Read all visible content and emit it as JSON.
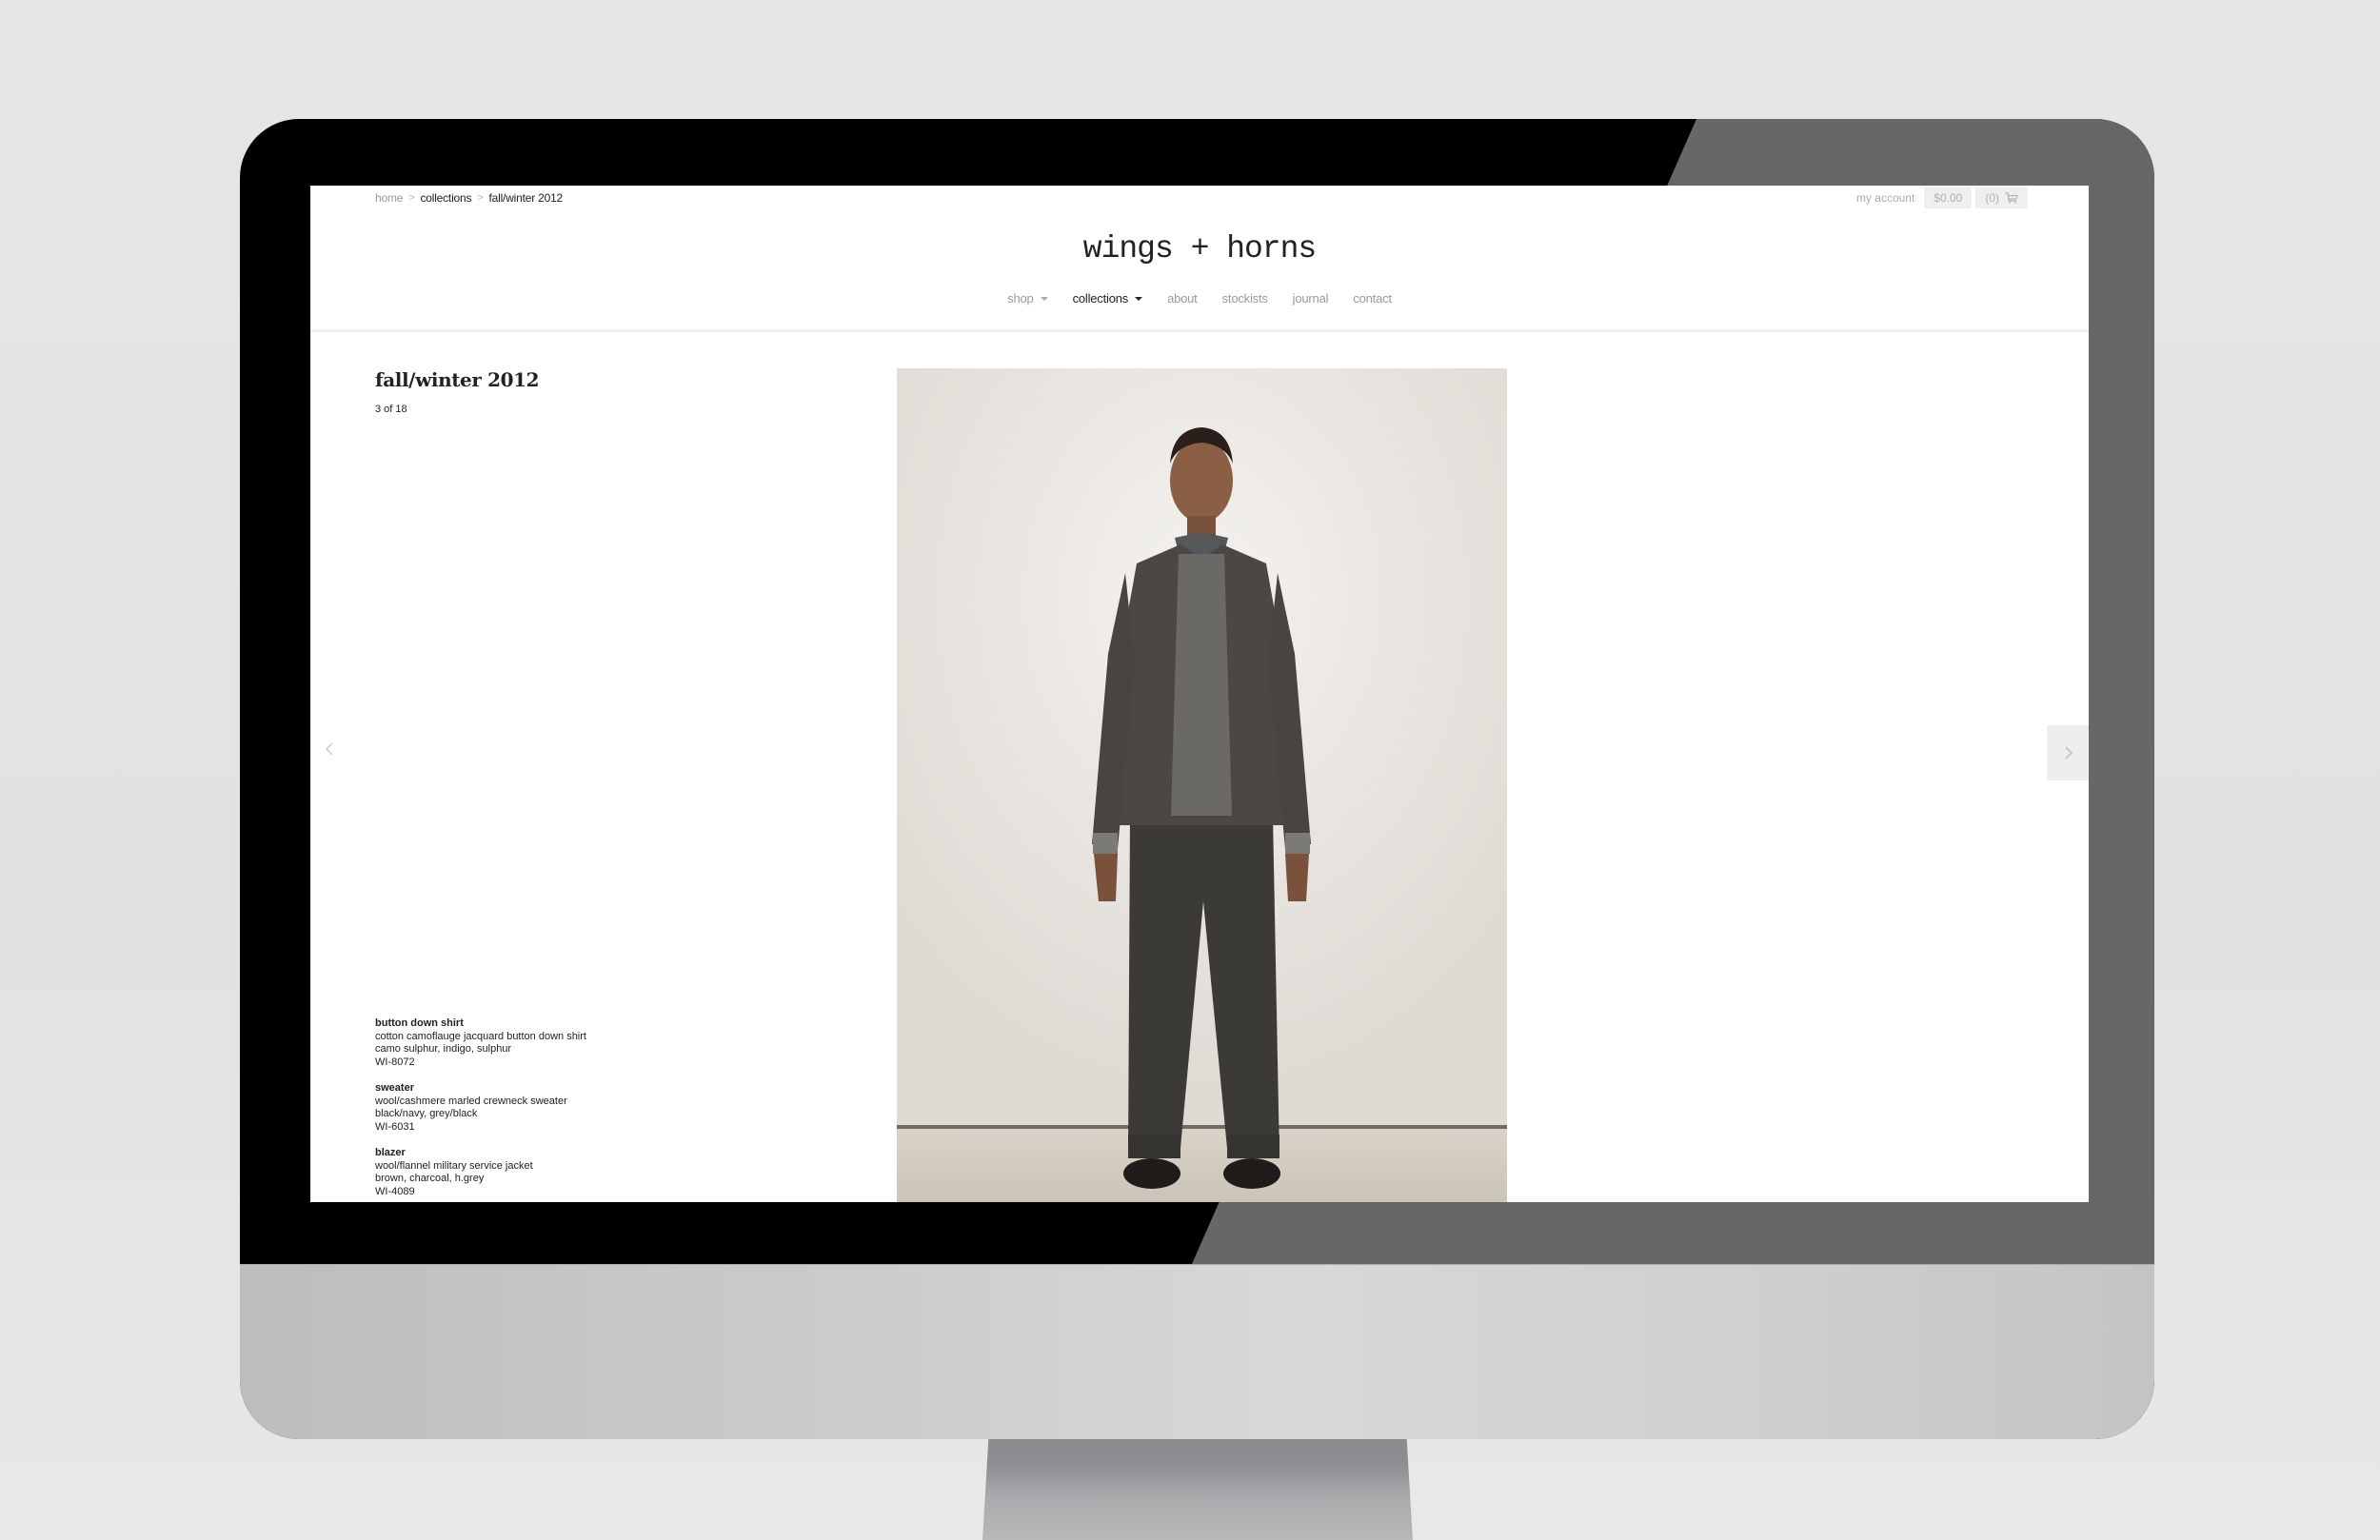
{
  "breadcrumb": {
    "items": [
      "home",
      "collections",
      "fall/winter 2012"
    ],
    "separator": ">"
  },
  "account": {
    "my_account_label": "my account",
    "cart_total": "$0.00",
    "cart_count": "(0)"
  },
  "brand": {
    "logo_text": "wings + horns"
  },
  "nav": {
    "items": [
      {
        "label": "shop",
        "has_dropdown": true,
        "active": false
      },
      {
        "label": "collections",
        "has_dropdown": true,
        "active": true
      },
      {
        "label": "about",
        "has_dropdown": false,
        "active": false
      },
      {
        "label": "stockists",
        "has_dropdown": false,
        "active": false
      },
      {
        "label": "journal",
        "has_dropdown": false,
        "active": false
      },
      {
        "label": "contact",
        "has_dropdown": false,
        "active": false
      }
    ]
  },
  "collection": {
    "title": "fall/winter 2012",
    "counter": "3 of 18",
    "current_index": 3,
    "total": 18
  },
  "look_photo": {
    "icon": "lookbook-photo",
    "description": "Model in grey wool flannel blazer, marled crewneck sweater, camo button down shirt and cargo trousers"
  },
  "products": [
    {
      "name": "button down shirt",
      "description": "cotton camoflauge jacquard button down shirt",
      "colors": "camo sulphur, indigo, sulphur",
      "sku": "WI-8072"
    },
    {
      "name": "sweater",
      "description": "wool/cashmere marled crewneck sweater",
      "colors": "black/navy, grey/black",
      "sku": "WI-6031"
    },
    {
      "name": "blazer",
      "description": "wool/flannel military service jacket",
      "colors": "brown, charcoal, h.grey",
      "sku": "WI-4089"
    }
  ],
  "controls": {
    "prev_icon": "chevron-left-icon",
    "next_icon": "chevron-right-icon",
    "cart_icon": "cart-icon"
  },
  "colors": {
    "text_primary": "#222222",
    "text_muted": "#9a9a9a",
    "page_background": "#ffffff",
    "cart_background": "#efefef"
  }
}
